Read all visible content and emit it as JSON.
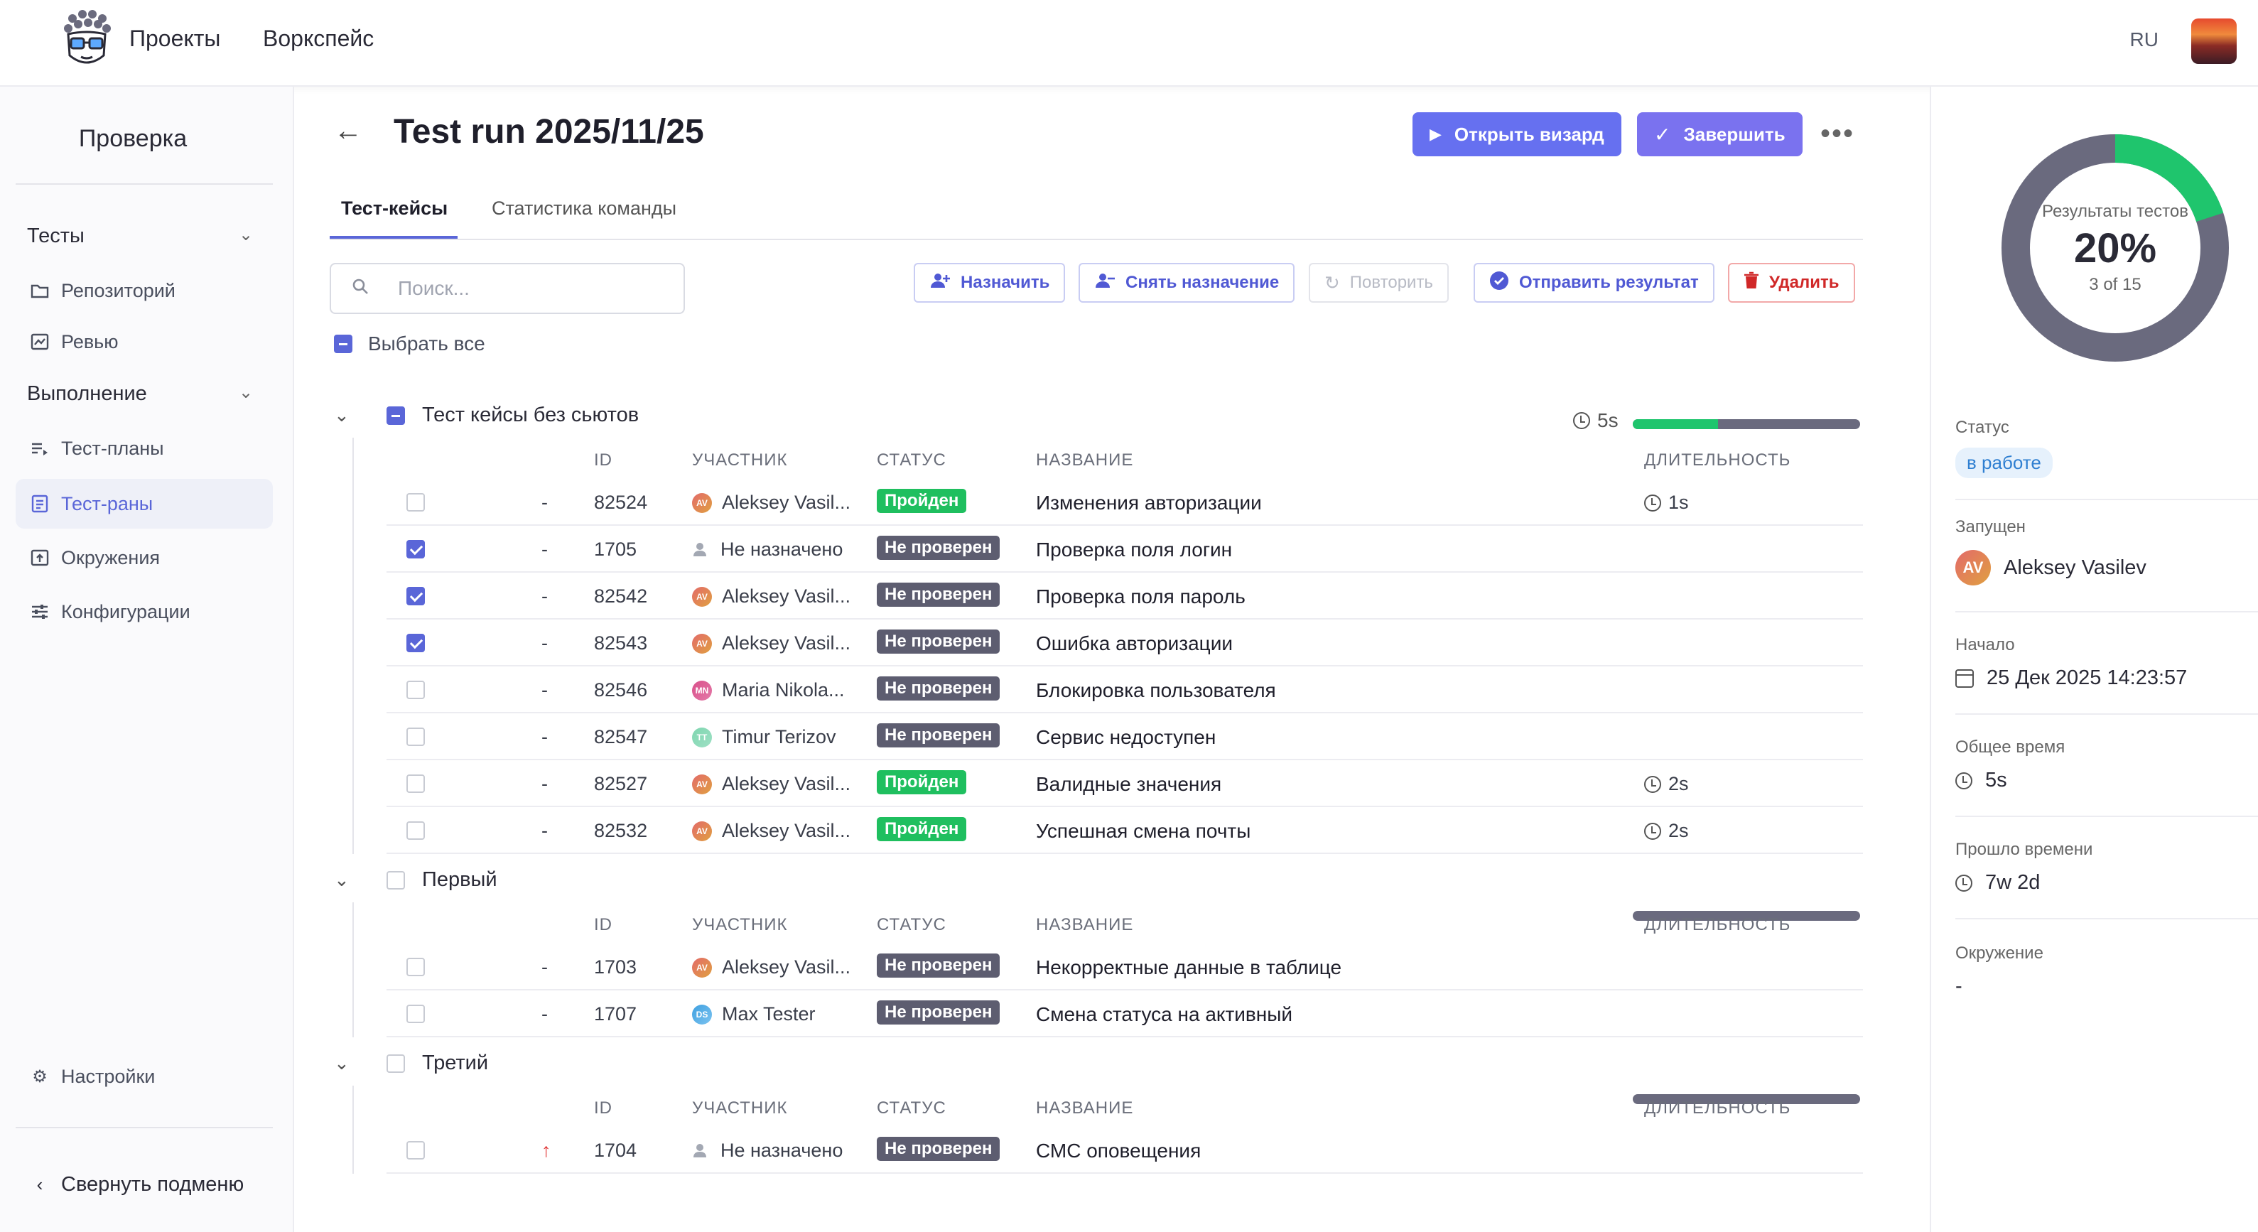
{
  "header": {
    "nav": [
      "Проекты",
      "Воркспейс"
    ],
    "lang": "RU"
  },
  "sidebar": {
    "title": "Проверка",
    "groups": [
      {
        "label": "Тесты",
        "items": [
          {
            "label": "Репозиторий",
            "icon": "folder-icon"
          },
          {
            "label": "Ревью",
            "icon": "review-icon"
          }
        ]
      },
      {
        "label": "Выполнение",
        "items": [
          {
            "label": "Тест-планы",
            "icon": "list-icon"
          },
          {
            "label": "Тест-раны",
            "icon": "clipboard-icon",
            "active": true
          },
          {
            "label": "Окружения",
            "icon": "environment-icon"
          },
          {
            "label": "Конфигурации",
            "icon": "sliders-icon"
          }
        ]
      }
    ],
    "settings": "Настройки",
    "collapse": "Свернуть подменю"
  },
  "page": {
    "title": "Test run 2025/11/25",
    "open_wizard": "Открыть визард",
    "finish": "Завершить",
    "tabs": [
      "Тест-кейсы",
      "Статистика команды"
    ],
    "search_placeholder": "Поиск...",
    "actions": {
      "assign": "Назначить",
      "unassign": "Снять назначение",
      "retry": "Повторить",
      "submit": "Отправить результат",
      "delete": "Удалить"
    },
    "select_all": "Выбрать все"
  },
  "columns": {
    "id": "ID",
    "assignee": "УЧАСТНИК",
    "status": "СТАТУС",
    "name": "НАЗВАНИЕ",
    "duration": "ДЛИТЕЛЬНОСТЬ"
  },
  "suites": [
    {
      "name": "Тест кейсы без сьютов",
      "time": "5s",
      "passed_fraction": 0.375,
      "rows": [
        {
          "checked": false,
          "prio": "-",
          "id": "82524",
          "initials": "AV",
          "assignee": "Aleksey Vasil...",
          "status": "Пройден",
          "status_kind": "passed",
          "name": "Изменения авторизации",
          "duration": "1s"
        },
        {
          "checked": true,
          "prio": "-",
          "id": "1705",
          "initials": "",
          "assignee": "Не назначено",
          "status": "Не проверен",
          "status_kind": "untested",
          "name": "Проверка поля логин",
          "duration": ""
        },
        {
          "checked": true,
          "prio": "-",
          "id": "82542",
          "initials": "AV",
          "assignee": "Aleksey Vasil...",
          "status": "Не проверен",
          "status_kind": "untested",
          "name": "Проверка поля пароль",
          "duration": ""
        },
        {
          "checked": true,
          "prio": "-",
          "id": "82543",
          "initials": "AV",
          "assignee": "Aleksey Vasil...",
          "status": "Не проверен",
          "status_kind": "untested",
          "name": "Ошибка авторизации",
          "duration": ""
        },
        {
          "checked": false,
          "prio": "-",
          "id": "82546",
          "initials": "MN",
          "assignee": "Maria Nikola...",
          "status": "Не проверен",
          "status_kind": "untested",
          "name": "Блокировка пользователя",
          "duration": ""
        },
        {
          "checked": false,
          "prio": "-",
          "id": "82547",
          "initials": "TT",
          "assignee": "Timur Terizov",
          "status": "Не проверен",
          "status_kind": "untested",
          "name": "Сервис недоступен",
          "duration": ""
        },
        {
          "checked": false,
          "prio": "-",
          "id": "82527",
          "initials": "AV",
          "assignee": "Aleksey Vasil...",
          "status": "Пройден",
          "status_kind": "passed",
          "name": "Валидные значения",
          "duration": "2s"
        },
        {
          "checked": false,
          "prio": "-",
          "id": "82532",
          "initials": "AV",
          "assignee": "Aleksey Vasil...",
          "status": "Пройден",
          "status_kind": "passed",
          "name": "Успешная смена почты",
          "duration": "2s"
        }
      ]
    },
    {
      "name": "Первый",
      "time": "",
      "passed_fraction": 0,
      "rows": [
        {
          "checked": false,
          "prio": "-",
          "id": "1703",
          "initials": "AV",
          "assignee": "Aleksey Vasil...",
          "status": "Не проверен",
          "status_kind": "untested",
          "name": "Некорректные данные в таблице",
          "duration": ""
        },
        {
          "checked": false,
          "prio": "-",
          "id": "1707",
          "initials": "DS",
          "assignee": "Max Tester",
          "status": "Не проверен",
          "status_kind": "untested",
          "name": "Смена статуса на активный",
          "duration": ""
        }
      ]
    },
    {
      "name": "Третий",
      "time": "",
      "passed_fraction": 0,
      "rows": [
        {
          "checked": false,
          "prio": "↑",
          "id": "1704",
          "initials": "",
          "assignee": "Не назначено",
          "status": "Не проверен",
          "status_kind": "untested",
          "name": "СМС оповещения",
          "duration": ""
        }
      ]
    }
  ],
  "summary": {
    "chart_label": "Результаты тестов",
    "percent": "20%",
    "count": "3 of 15",
    "passed_fraction": 0.2,
    "colors": {
      "passed": "#1fc56d",
      "rest": "#6a6a7e"
    },
    "status_label": "Статус",
    "status_value": "в работе",
    "started_by_label": "Запущен",
    "started_by_initials": "AV",
    "started_by": "Aleksey Vasilev",
    "start_label": "Начало",
    "start_value": "25 Дек 2025 14:23:57",
    "total_time_label": "Общее время",
    "total_time_value": "5s",
    "elapsed_label": "Прошло времени",
    "elapsed_value": "7w 2d",
    "env_label": "Окружение",
    "env_value": "-"
  }
}
